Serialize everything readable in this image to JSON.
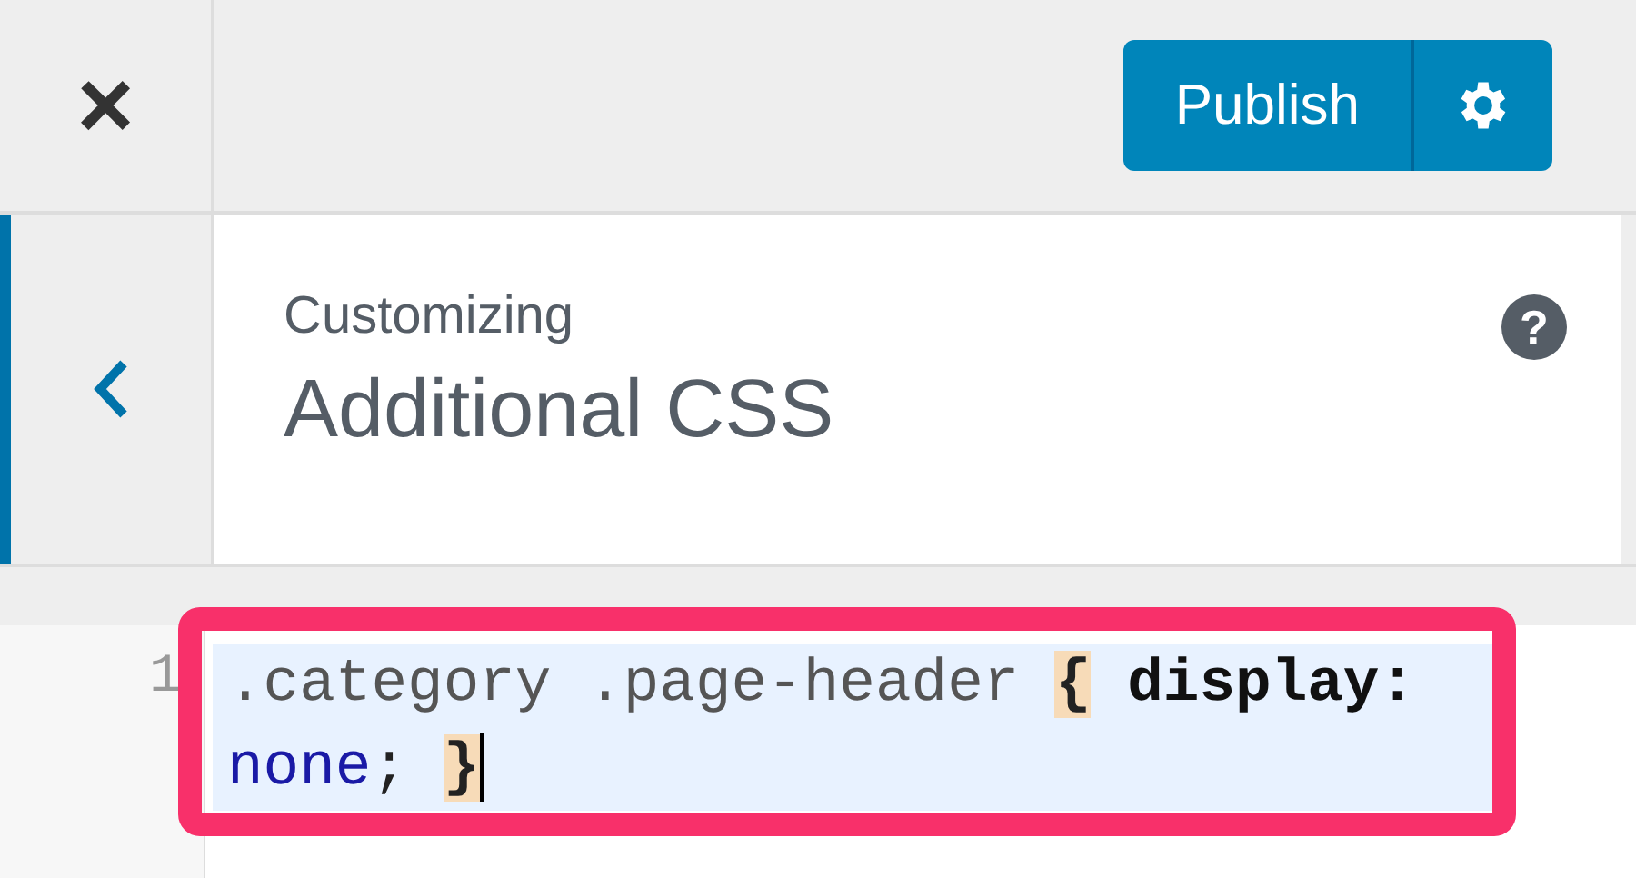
{
  "header": {
    "close_label": "×",
    "publish_label": "Publish"
  },
  "section": {
    "eyebrow": "Customizing",
    "title": "Additional CSS",
    "help": "?"
  },
  "editor": {
    "lines": [
      {
        "number": "1",
        "active": true,
        "tokens": [
          {
            "kind": "selector",
            "text": ".category .page-header "
          },
          {
            "kind": "bracket",
            "text": "{"
          },
          {
            "kind": "property",
            "text": " display: "
          },
          {
            "kind": "keyword",
            "text": "none"
          },
          {
            "kind": "plain",
            "text": "; "
          },
          {
            "kind": "bracket",
            "text": "}"
          }
        ]
      }
    ],
    "highlighted": true
  }
}
